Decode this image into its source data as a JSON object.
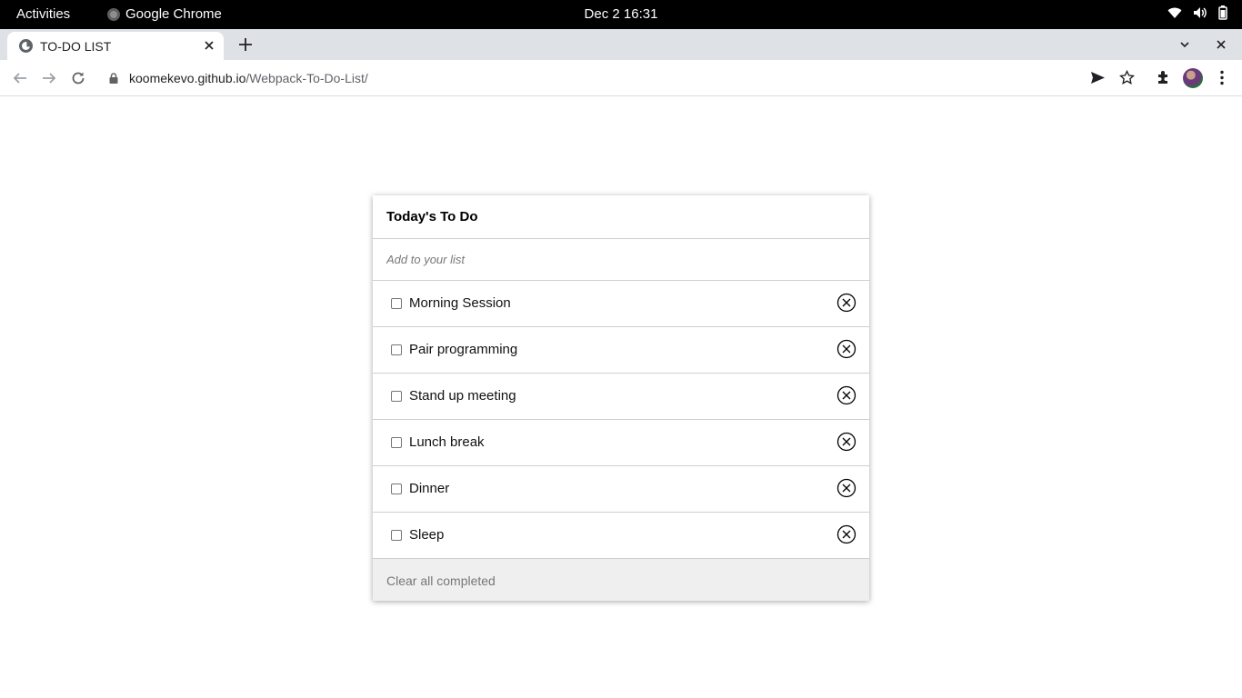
{
  "system": {
    "activities_label": "Activities",
    "app_name": "Google Chrome",
    "clock": "Dec 2  16:31"
  },
  "browser": {
    "tab_title": "TO-DO LIST",
    "url_host": "koomekevo.github.io",
    "url_path": "/Webpack-To-Do-List/"
  },
  "todo": {
    "title": "Today's To Do",
    "input_placeholder": "Add to your list",
    "items": [
      {
        "label": "Morning Session",
        "completed": false
      },
      {
        "label": "Pair programming",
        "completed": false
      },
      {
        "label": "Stand up meeting",
        "completed": false
      },
      {
        "label": "Lunch break",
        "completed": false
      },
      {
        "label": "Dinner",
        "completed": false
      },
      {
        "label": "Sleep",
        "completed": false
      }
    ],
    "clear_label": "Clear all completed"
  }
}
